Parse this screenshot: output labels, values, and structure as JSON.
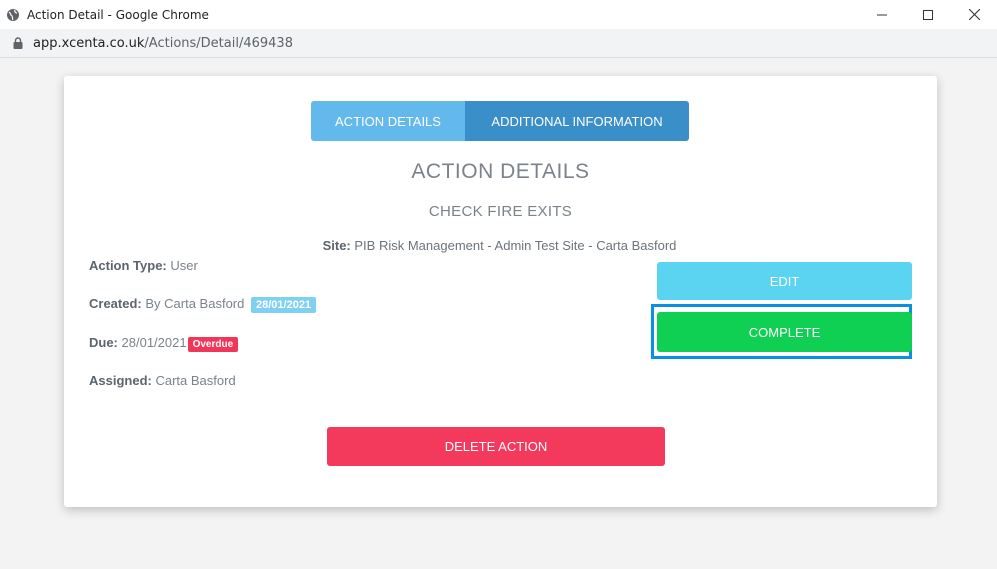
{
  "window": {
    "title": "Action Detail - Google Chrome",
    "url_domain": "app.xcenta.co.uk",
    "url_path": "/Actions/Detail/469438",
    "icons": {
      "globe": "globe-icon",
      "lock": "lock-icon",
      "minimize": "minimize-icon",
      "maximize": "maximize-icon",
      "close": "close-icon"
    }
  },
  "tabs": {
    "details_label": "ACTION DETAILS",
    "additional_label": "ADDITIONAL INFORMATION"
  },
  "main": {
    "heading": "ACTION DETAILS",
    "action_title": "CHECK FIRE EXITS",
    "site_label": "Site:",
    "site_value": "PIB Risk Management - Admin Test Site - Carta Basford"
  },
  "fields": {
    "type_label": "Action Type:",
    "type_value": "User",
    "created_label": "Created:",
    "created_value": "By Carta Basford",
    "created_date": "28/01/2021",
    "due_label": "Due:",
    "due_value": "28/01/2021",
    "due_status": "Overdue",
    "assigned_label": "Assigned:",
    "assigned_value": "Carta Basford"
  },
  "buttons": {
    "edit": "EDIT",
    "complete": "COMPLETE",
    "delete": "DELETE ACTION"
  },
  "colors": {
    "tab_active": "#63b8ec",
    "tab_inactive": "#3b8fc8",
    "edit": "#5ad4f1",
    "complete": "#0fd053",
    "delete": "#f33a5c",
    "overdue": "#f0375a",
    "date_badge": "#7fd0f2",
    "highlight": "#0b8fe0"
  }
}
